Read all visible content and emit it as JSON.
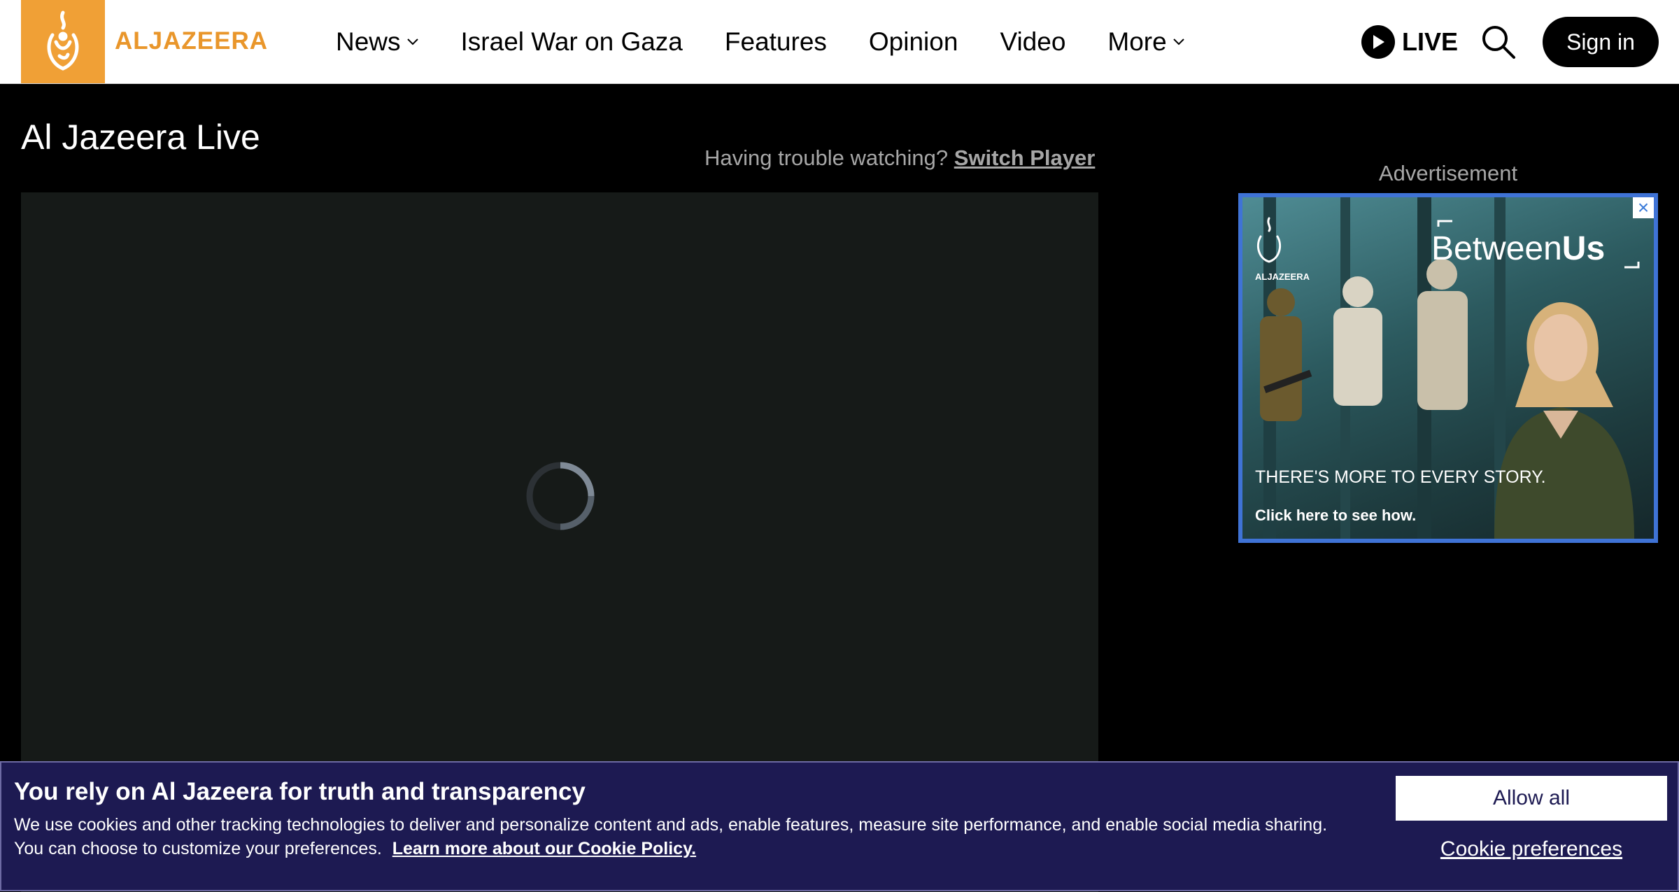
{
  "header": {
    "brand": "ALJAZEERA",
    "logo_icon": "aljazeera-calligraphy-logo-icon",
    "nav": [
      {
        "label": "News",
        "has_dropdown": true
      },
      {
        "label": "Israel War on Gaza",
        "has_dropdown": false
      },
      {
        "label": "Features",
        "has_dropdown": false
      },
      {
        "label": "Opinion",
        "has_dropdown": false
      },
      {
        "label": "Video",
        "has_dropdown": false
      },
      {
        "label": "More",
        "has_dropdown": true
      }
    ],
    "live_label": "LIVE",
    "sign_in_label": "Sign in",
    "colors": {
      "brand_orange": "#f0a036",
      "brand_text": "#e9962b"
    }
  },
  "main": {
    "title": "Al Jazeera Live",
    "trouble_text": "Having trouble watching?",
    "switch_player_label": "Switch Player",
    "player_state": "loading"
  },
  "ad": {
    "label": "Advertisement",
    "brand": "ALJAZEERA",
    "headline_part1": "Between",
    "headline_part2": "Us",
    "tagline": "THERE'S MORE TO EVERY STORY.",
    "cta": "Click here to see how.",
    "close_icon": "×",
    "border_color": "#3f73d6"
  },
  "cookie": {
    "title": "You rely on Al Jazeera for truth and transparency",
    "body": "We use cookies and other tracking technologies to deliver and personalize content and ads, enable features, measure site performance, and enable social media sharing. You can choose to customize your preferences.",
    "policy_link": "Learn more about our Cookie Policy.",
    "allow_all_label": "Allow all",
    "preferences_label": "Cookie preferences",
    "background": "#1d1a52"
  }
}
